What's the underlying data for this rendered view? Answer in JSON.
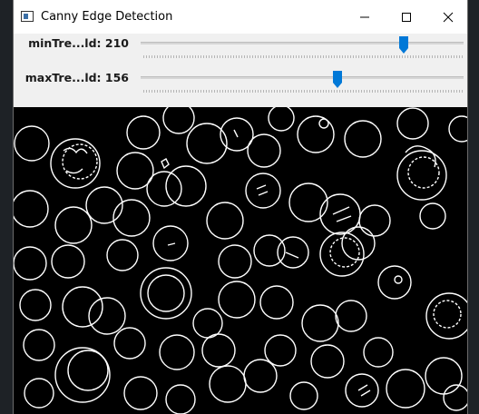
{
  "window": {
    "title": "Canny Edge Detection",
    "icon": "window-app-icon",
    "buttons": [
      "minimize-icon",
      "maximize-icon",
      "close-icon"
    ]
  },
  "trackbars": [
    {
      "label": "minTre...ld: 210",
      "value": 210,
      "max": 255
    },
    {
      "label": "maxTre...ld: 156",
      "value": 156,
      "max": 255
    }
  ],
  "colors": {
    "accent": "#0078d7",
    "background": "#1e2226",
    "canvas": "#000000",
    "edges": "#ffffff"
  }
}
